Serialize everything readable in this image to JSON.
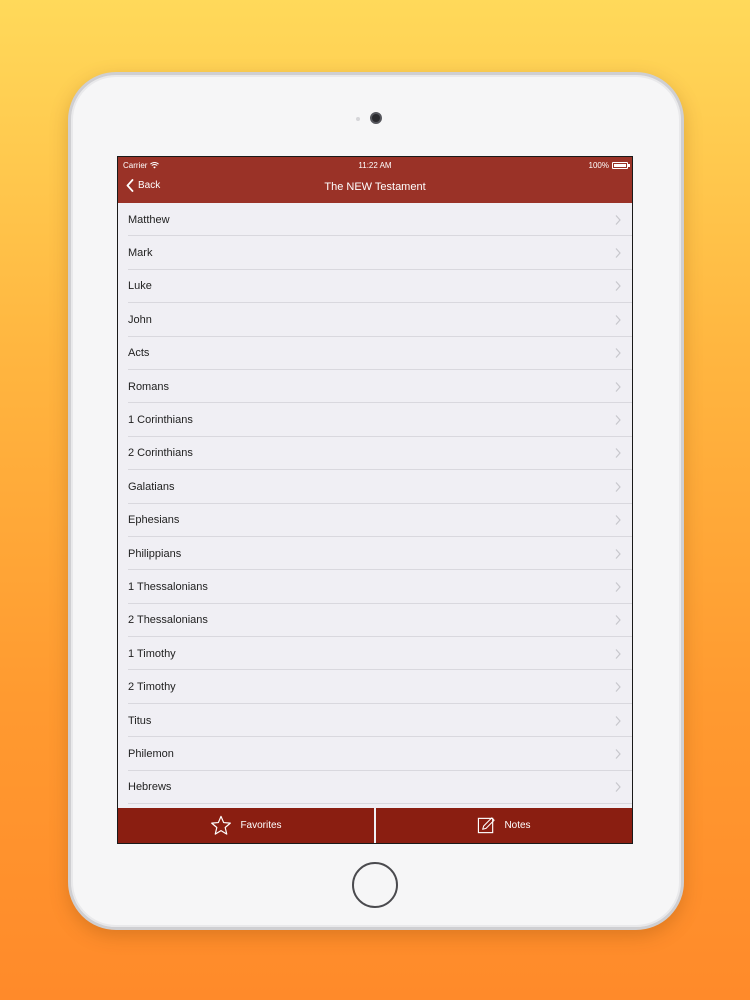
{
  "status_bar": {
    "carrier": "Carrier",
    "time": "11:22 AM",
    "battery": "100%"
  },
  "nav": {
    "back_label": "Back",
    "title": "The NEW Testament"
  },
  "books": [
    {
      "label": "Matthew"
    },
    {
      "label": "Mark"
    },
    {
      "label": "Luke"
    },
    {
      "label": "John"
    },
    {
      "label": "Acts"
    },
    {
      "label": "Romans"
    },
    {
      "label": "1 Corinthians"
    },
    {
      "label": "2 Corinthians"
    },
    {
      "label": "Galatians"
    },
    {
      "label": "Ephesians"
    },
    {
      "label": "Philippians"
    },
    {
      "label": "1 Thessalonians"
    },
    {
      "label": "2 Thessalonians"
    },
    {
      "label": "1 Timothy"
    },
    {
      "label": "2 Timothy"
    },
    {
      "label": "Titus"
    },
    {
      "label": "Philemon"
    },
    {
      "label": "Hebrews"
    }
  ],
  "tabs": {
    "favorites_label": "Favorites",
    "notes_label": "Notes"
  },
  "colors": {
    "nav_bar": "#9A3227",
    "tab_bar": "#8A1E11",
    "background_top": "#FFD95A",
    "background_bottom": "#FF8A2A"
  }
}
